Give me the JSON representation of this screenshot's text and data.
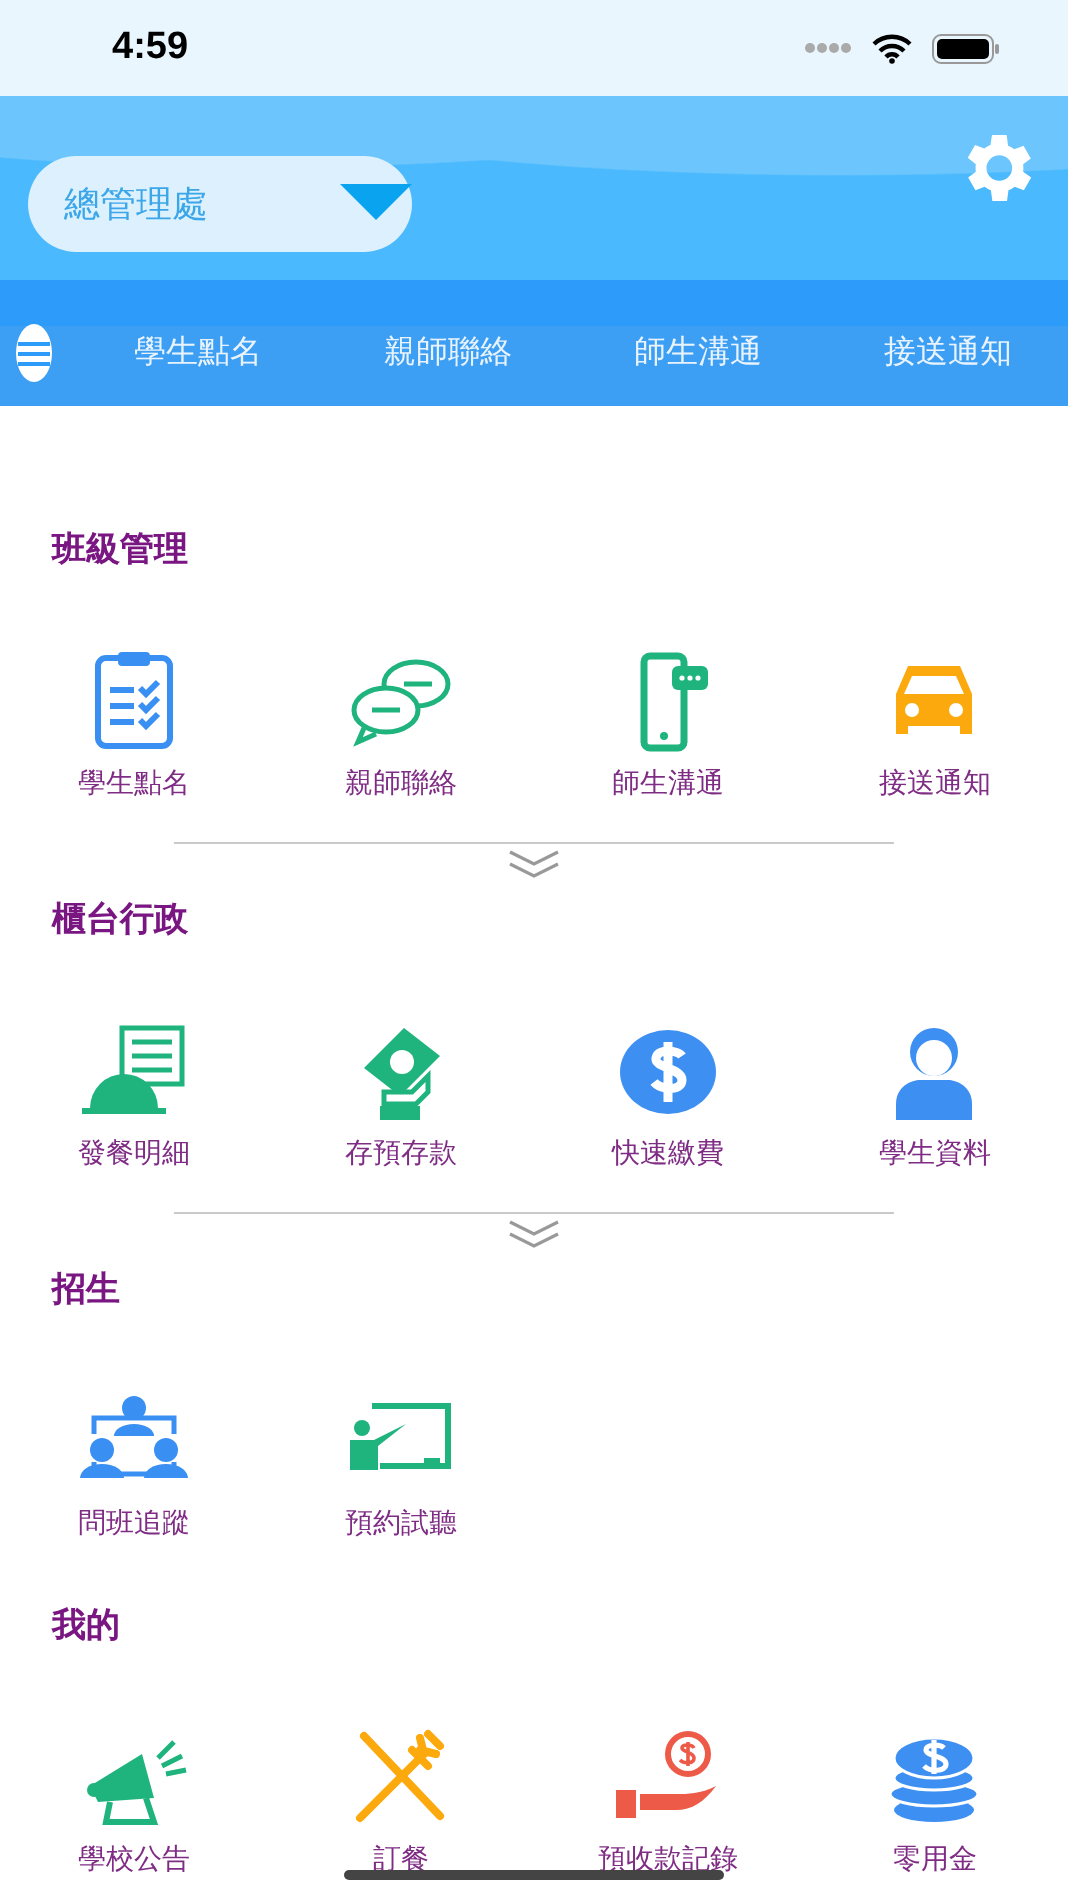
{
  "status_bar": {
    "time": "4:59"
  },
  "header": {
    "school_select": "總管理處"
  },
  "tabs": [
    "學生點名",
    "親師聯絡",
    "師生溝通",
    "接送通知"
  ],
  "sections": [
    {
      "title": "班級管理",
      "expandable": true,
      "items": [
        {
          "label": "學生點名",
          "kind": "clipboard"
        },
        {
          "label": "親師聯絡",
          "kind": "chat"
        },
        {
          "label": "師生溝通",
          "kind": "phone"
        },
        {
          "label": "接送通知",
          "kind": "car"
        }
      ]
    },
    {
      "title": "櫃台行政",
      "expandable": true,
      "items": [
        {
          "label": "發餐明細",
          "kind": "cloche"
        },
        {
          "label": "存預存款",
          "kind": "cash"
        },
        {
          "label": "快速繳費",
          "kind": "dollar"
        },
        {
          "label": "學生資料",
          "kind": "person"
        }
      ]
    },
    {
      "title": "招生",
      "expandable": false,
      "items": [
        {
          "label": "問班追蹤",
          "kind": "people"
        },
        {
          "label": "預約試聽",
          "kind": "teacher"
        }
      ]
    },
    {
      "title": "我的",
      "expandable": false,
      "items": [
        {
          "label": "學校公告",
          "kind": "megaphone"
        },
        {
          "label": "訂餐",
          "kind": "cutlery"
        },
        {
          "label": "預收款記錄",
          "kind": "coinhand"
        },
        {
          "label": "零用金",
          "kind": "coins"
        }
      ]
    }
  ]
}
